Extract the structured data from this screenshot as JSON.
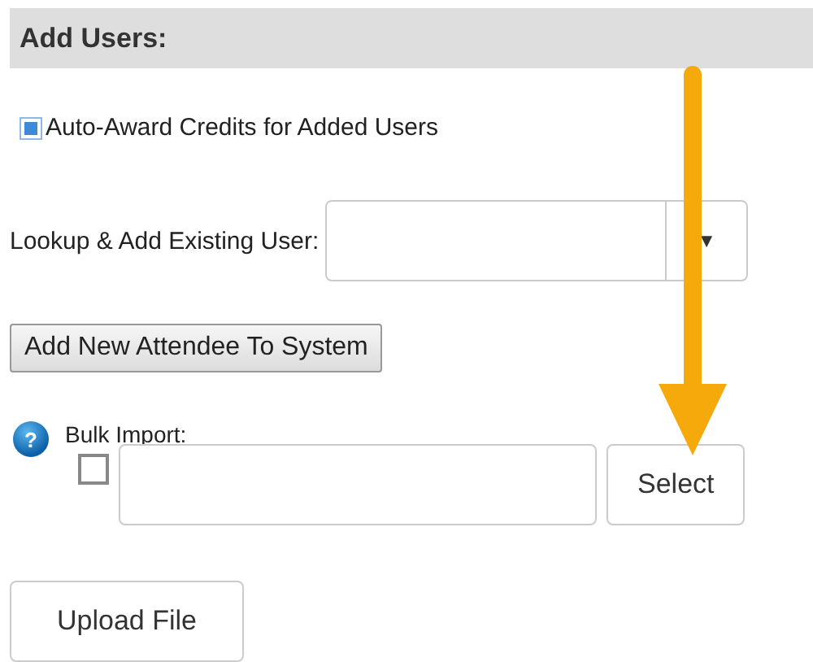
{
  "section": {
    "title": "Add Users:"
  },
  "auto_award": {
    "label": "Auto-Award Credits for Added Users",
    "checked": true
  },
  "lookup": {
    "label": "Lookup & Add Existing User:",
    "caret": "▼"
  },
  "add_new_button": "Add New Attendee To System",
  "bulk_import": {
    "label": "Bulk Import:",
    "help": "?",
    "checked": false,
    "select_button": "Select"
  },
  "upload_button": "Upload File"
}
